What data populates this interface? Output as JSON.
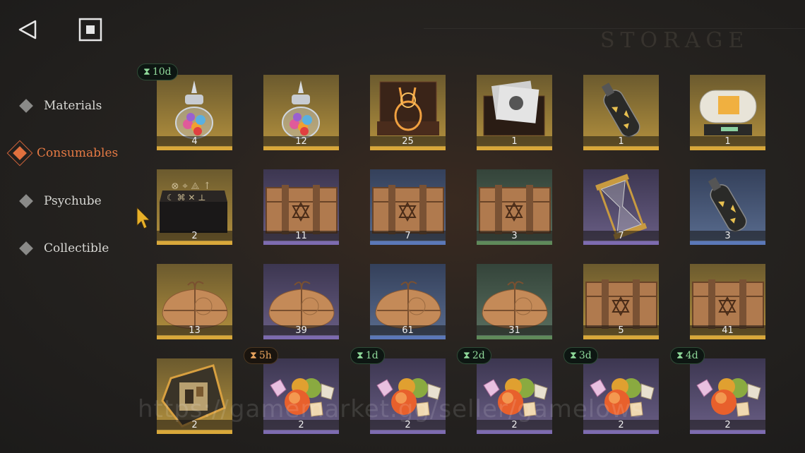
{
  "header": {
    "bg_title": "STORAGE",
    "back_icon": "back-triangle-icon",
    "home_icon": "home-square-icon"
  },
  "categories": [
    {
      "label": "Materials",
      "active": false
    },
    {
      "label": "Consumables",
      "active": true
    },
    {
      "label": "Psychube",
      "active": false
    },
    {
      "label": "Collectible",
      "active": false
    }
  ],
  "colors": {
    "gold": "#d9a83a",
    "purple": "#7d6bb0",
    "blue": "#5b78b8",
    "green": "#5f8a5a",
    "accent": "#e0703e"
  },
  "items": [
    {
      "name": "candy-jar",
      "count": "4",
      "rarity": "gold",
      "timer": "10d",
      "timer_color": "green"
    },
    {
      "name": "candy-jar",
      "count": "12",
      "rarity": "gold"
    },
    {
      "name": "golden-rabbit-box",
      "count": "25",
      "rarity": "gold"
    },
    {
      "name": "photo-chest",
      "count": "1",
      "rarity": "gold"
    },
    {
      "name": "bottle-shards",
      "count": "1",
      "rarity": "gold"
    },
    {
      "name": "capsule-machine",
      "count": "1",
      "rarity": "gold"
    },
    {
      "name": "rune-table",
      "count": "2",
      "rarity": "gold"
    },
    {
      "name": "wooden-crate",
      "count": "11",
      "rarity": "purple"
    },
    {
      "name": "wooden-crate",
      "count": "7",
      "rarity": "blue"
    },
    {
      "name": "wooden-crate",
      "count": "3",
      "rarity": "green"
    },
    {
      "name": "hourglass",
      "count": "7",
      "rarity": "purple"
    },
    {
      "name": "bottle-shards",
      "count": "3",
      "rarity": "blue"
    },
    {
      "name": "parcel",
      "count": "13",
      "rarity": "gold"
    },
    {
      "name": "parcel",
      "count": "39",
      "rarity": "purple"
    },
    {
      "name": "parcel",
      "count": "61",
      "rarity": "blue"
    },
    {
      "name": "parcel",
      "count": "31",
      "rarity": "green"
    },
    {
      "name": "wooden-crate",
      "count": "5",
      "rarity": "gold"
    },
    {
      "name": "wooden-crate",
      "count": "41",
      "rarity": "gold"
    },
    {
      "name": "puzzle-badge",
      "count": "2",
      "rarity": "gold"
    },
    {
      "name": "fruit-gems",
      "count": "2",
      "rarity": "purple",
      "timer": "5h",
      "timer_color": "orange"
    },
    {
      "name": "fruit-gems",
      "count": "2",
      "rarity": "purple",
      "timer": "1d",
      "timer_color": "green"
    },
    {
      "name": "fruit-gems",
      "count": "2",
      "rarity": "purple",
      "timer": "2d",
      "timer_color": "green"
    },
    {
      "name": "fruit-gems",
      "count": "2",
      "rarity": "purple",
      "timer": "3d",
      "timer_color": "green"
    },
    {
      "name": "fruit-gems",
      "count": "2",
      "rarity": "purple",
      "timer": "4d",
      "timer_color": "green"
    }
  ],
  "watermark": "https://gamemarket.gg/seller/gamelows"
}
